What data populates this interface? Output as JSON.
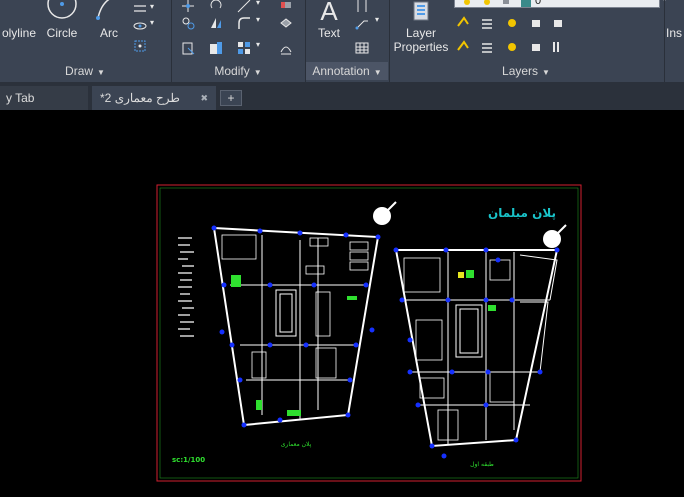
{
  "ribbon": {
    "draw_buttons": {
      "polyline": "olyline",
      "circle": "Circle",
      "arc": "Arc"
    },
    "annotation_text": "Text",
    "layer_properties": "Layer\nProperties",
    "layer_current": "0",
    "insert": "Ins",
    "panels": {
      "draw": "Draw",
      "modify": "Modify",
      "annotation": "Annotation",
      "layers": "Layers"
    }
  },
  "tabs": {
    "start_tab": "y Tab",
    "drawing_tab": "طرح معماری 2*",
    "close": "✖",
    "add": "+"
  },
  "drawing": {
    "furniture_title": "پلان مبلمان",
    "scale_label": "sc:1/100",
    "caption_left": "پلان معماری",
    "caption_right": "طبقه اول",
    "frame_color": "#d21f2f",
    "title_color": "#19c3c9"
  }
}
